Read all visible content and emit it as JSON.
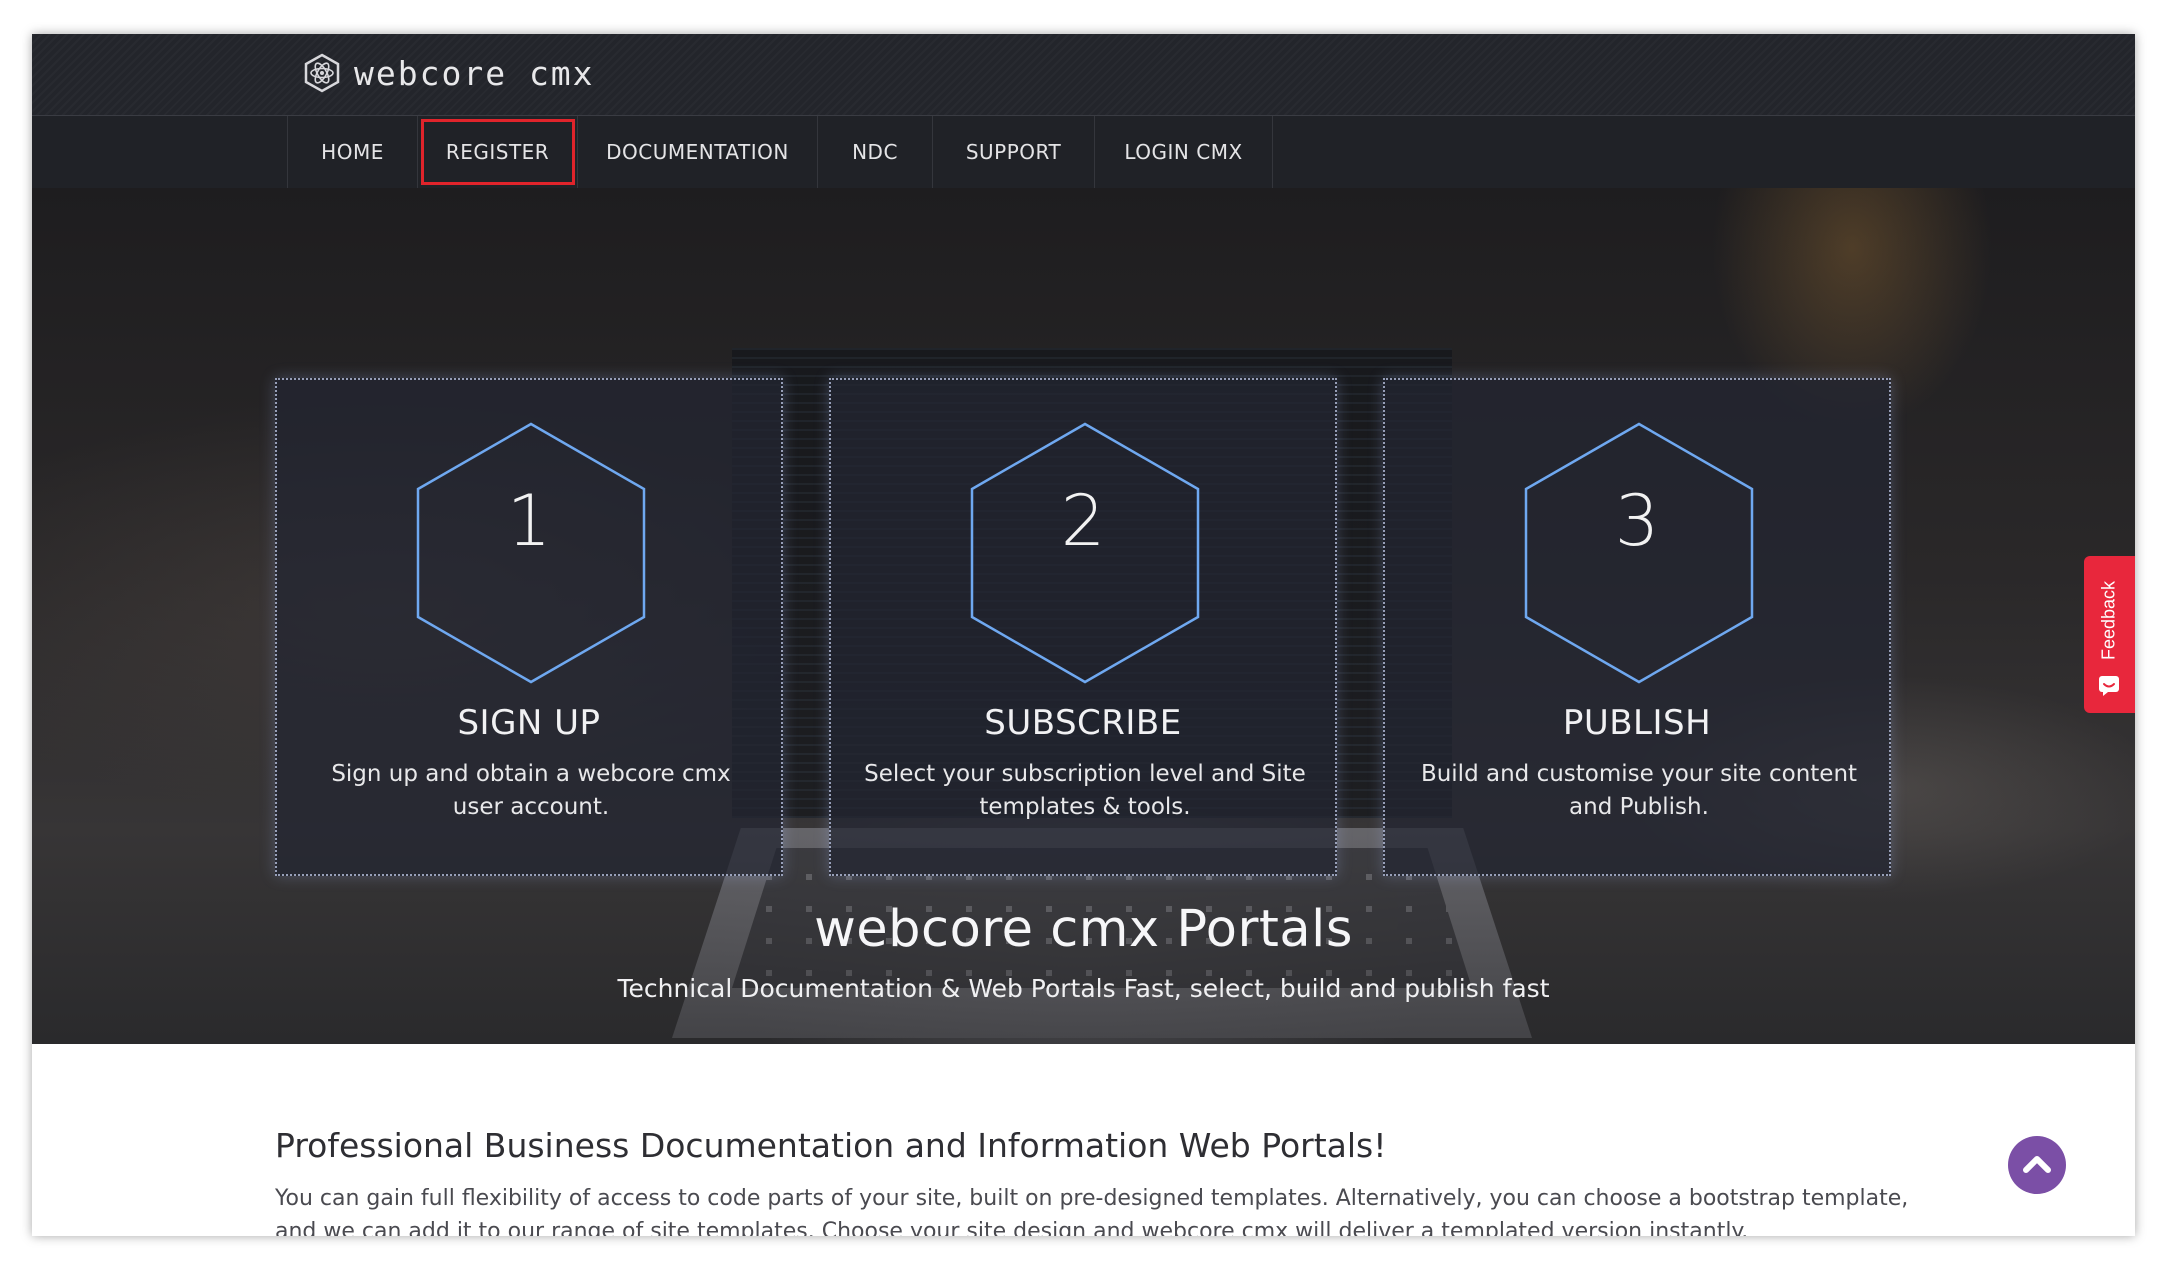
{
  "header": {
    "brand": "webcore cmx",
    "logo_icon": "atom-hexagon-icon"
  },
  "nav": {
    "items": [
      {
        "label": "HOME"
      },
      {
        "label": "REGISTER",
        "highlighted": true
      },
      {
        "label": "DOCUMENTATION"
      },
      {
        "label": "NDC"
      },
      {
        "label": "SUPPORT"
      },
      {
        "label": "LOGIN CMX"
      }
    ]
  },
  "hero": {
    "cards": [
      {
        "number": "1",
        "title": "SIGN UP",
        "description": "Sign up and obtain a webcore cmx user account."
      },
      {
        "number": "2",
        "title": "SUBSCRIBE",
        "description": "Select your subscription level and Site templates & tools."
      },
      {
        "number": "3",
        "title": "PUBLISH",
        "description": "Build and customise your site content and Publish."
      }
    ],
    "title": "webcore cmx Portals",
    "subtitle": "Technical Documentation & Web Portals Fast, select, build and publish fast"
  },
  "content": {
    "heading": "Professional Business Documentation and Information Web Portals!",
    "paragraph": "You can gain full flexibility of access to code parts of your site, built on pre-designed templates. Alternatively, you can choose a bootstrap template, and we can add it to our range of site templates. Choose your site design and webcore cmx will deliver a templated version instantly."
  },
  "feedback": {
    "label": "Feedback",
    "icon": "smiley-chat-icon"
  },
  "scroll_top": {
    "icon": "chevron-up-icon"
  },
  "colors": {
    "header_bg": "#23252b",
    "nav_highlight": "#e0242b",
    "hex_stroke": "#6fa8f0",
    "feedback_bg": "#e8273c",
    "scroll_top_bg": "#7b4fa6"
  }
}
